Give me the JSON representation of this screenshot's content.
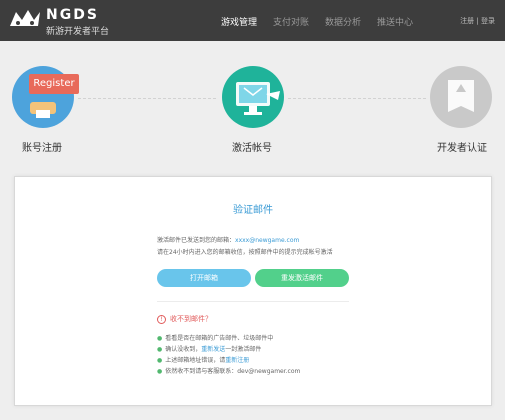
{
  "header": {
    "brand": "NGDS",
    "brand_sub": "新游开发者平台",
    "nav": [
      "游戏管理",
      "支付对账",
      "数据分析",
      "推送中心"
    ],
    "auth_register": "注册",
    "auth_sep": "|",
    "auth_login": "登录"
  },
  "steps": [
    {
      "label": "账号注册",
      "badge": "Register"
    },
    {
      "label": "激活帐号"
    },
    {
      "label": "开发者认证"
    }
  ],
  "card": {
    "title": "验证邮件",
    "line1_prefix": "激活邮件已发送到您的邮箱：",
    "email": "xxxx@newgame.com",
    "line2": "请在24小时内进入您的邮箱收信，按照邮件中的提示完成帐号激活",
    "btn_open": "打开邮箱",
    "btn_resend": "重发激活邮件",
    "warn": "收不到邮件？",
    "tip1": "看看是否在邮箱的广告邮件、垃圾邮件中",
    "tip2_prefix": "确认没收到，",
    "tip2_link": "重新发送",
    "tip2_suffix": "一封激活邮件",
    "tip3_prefix": "上述邮箱地址错误，请",
    "tip3_link": "重新注册",
    "tip4": "依然收不到请与客服联系：dev@newgamer.com"
  },
  "colors": {
    "header_bg": "#3d3d3d",
    "accent_blue": "#3a9bd5",
    "open_btn": "#69c5eb",
    "resend_btn": "#52d08b",
    "register_badge": "#e86a5a",
    "step1_circle": "#4da3dc",
    "step2_circle": "#1fb39a",
    "step3_circle": "#c9c9c9"
  }
}
